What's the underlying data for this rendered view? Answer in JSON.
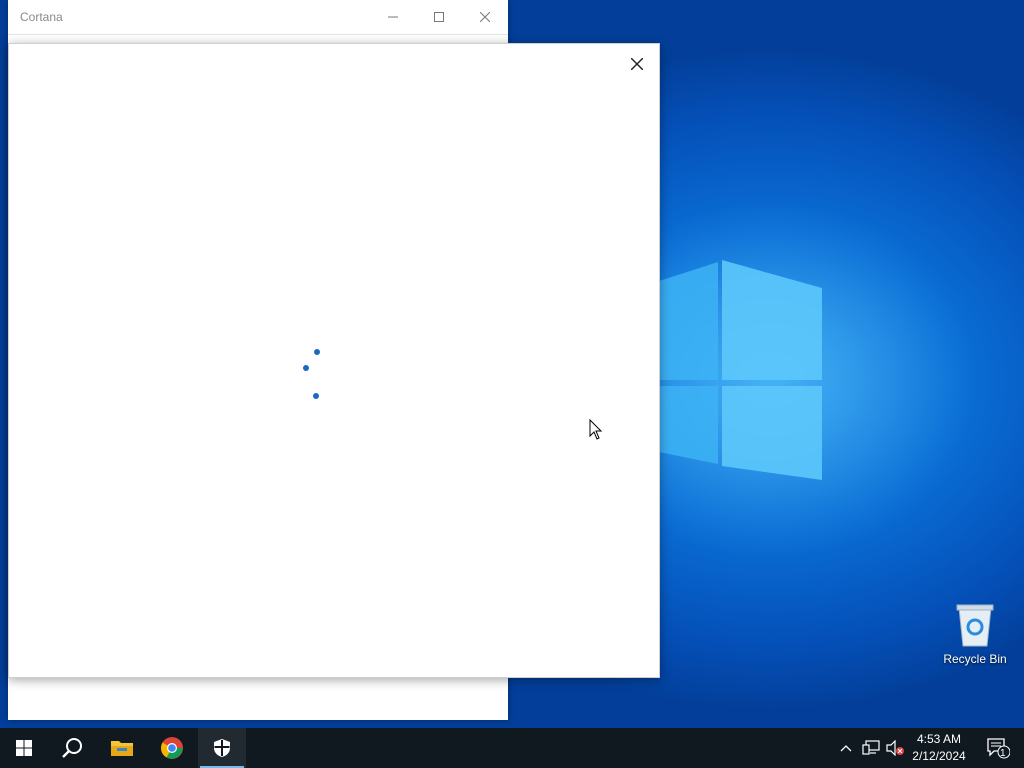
{
  "cortana_window": {
    "title": "Cortana"
  },
  "desktop_icons": [
    {
      "label": "Recycle Bin",
      "icon": "recycle-bin-icon"
    }
  ],
  "taskbar": {
    "pinned": [
      {
        "name": "start",
        "icon": "windows-start-icon"
      },
      {
        "name": "search",
        "icon": "search-icon"
      },
      {
        "name": "file-explorer",
        "icon": "folder-icon"
      },
      {
        "name": "chrome",
        "icon": "chrome-icon"
      },
      {
        "name": "windows-security",
        "icon": "shield-icon"
      }
    ],
    "tray": {
      "time": "4:53 AM",
      "date": "2/12/2024",
      "notification_count": "1"
    }
  },
  "colors": {
    "desktop_blue": "#0a6fd6",
    "taskbar": "#101820",
    "spinner_dot": "#1b6ac0"
  }
}
